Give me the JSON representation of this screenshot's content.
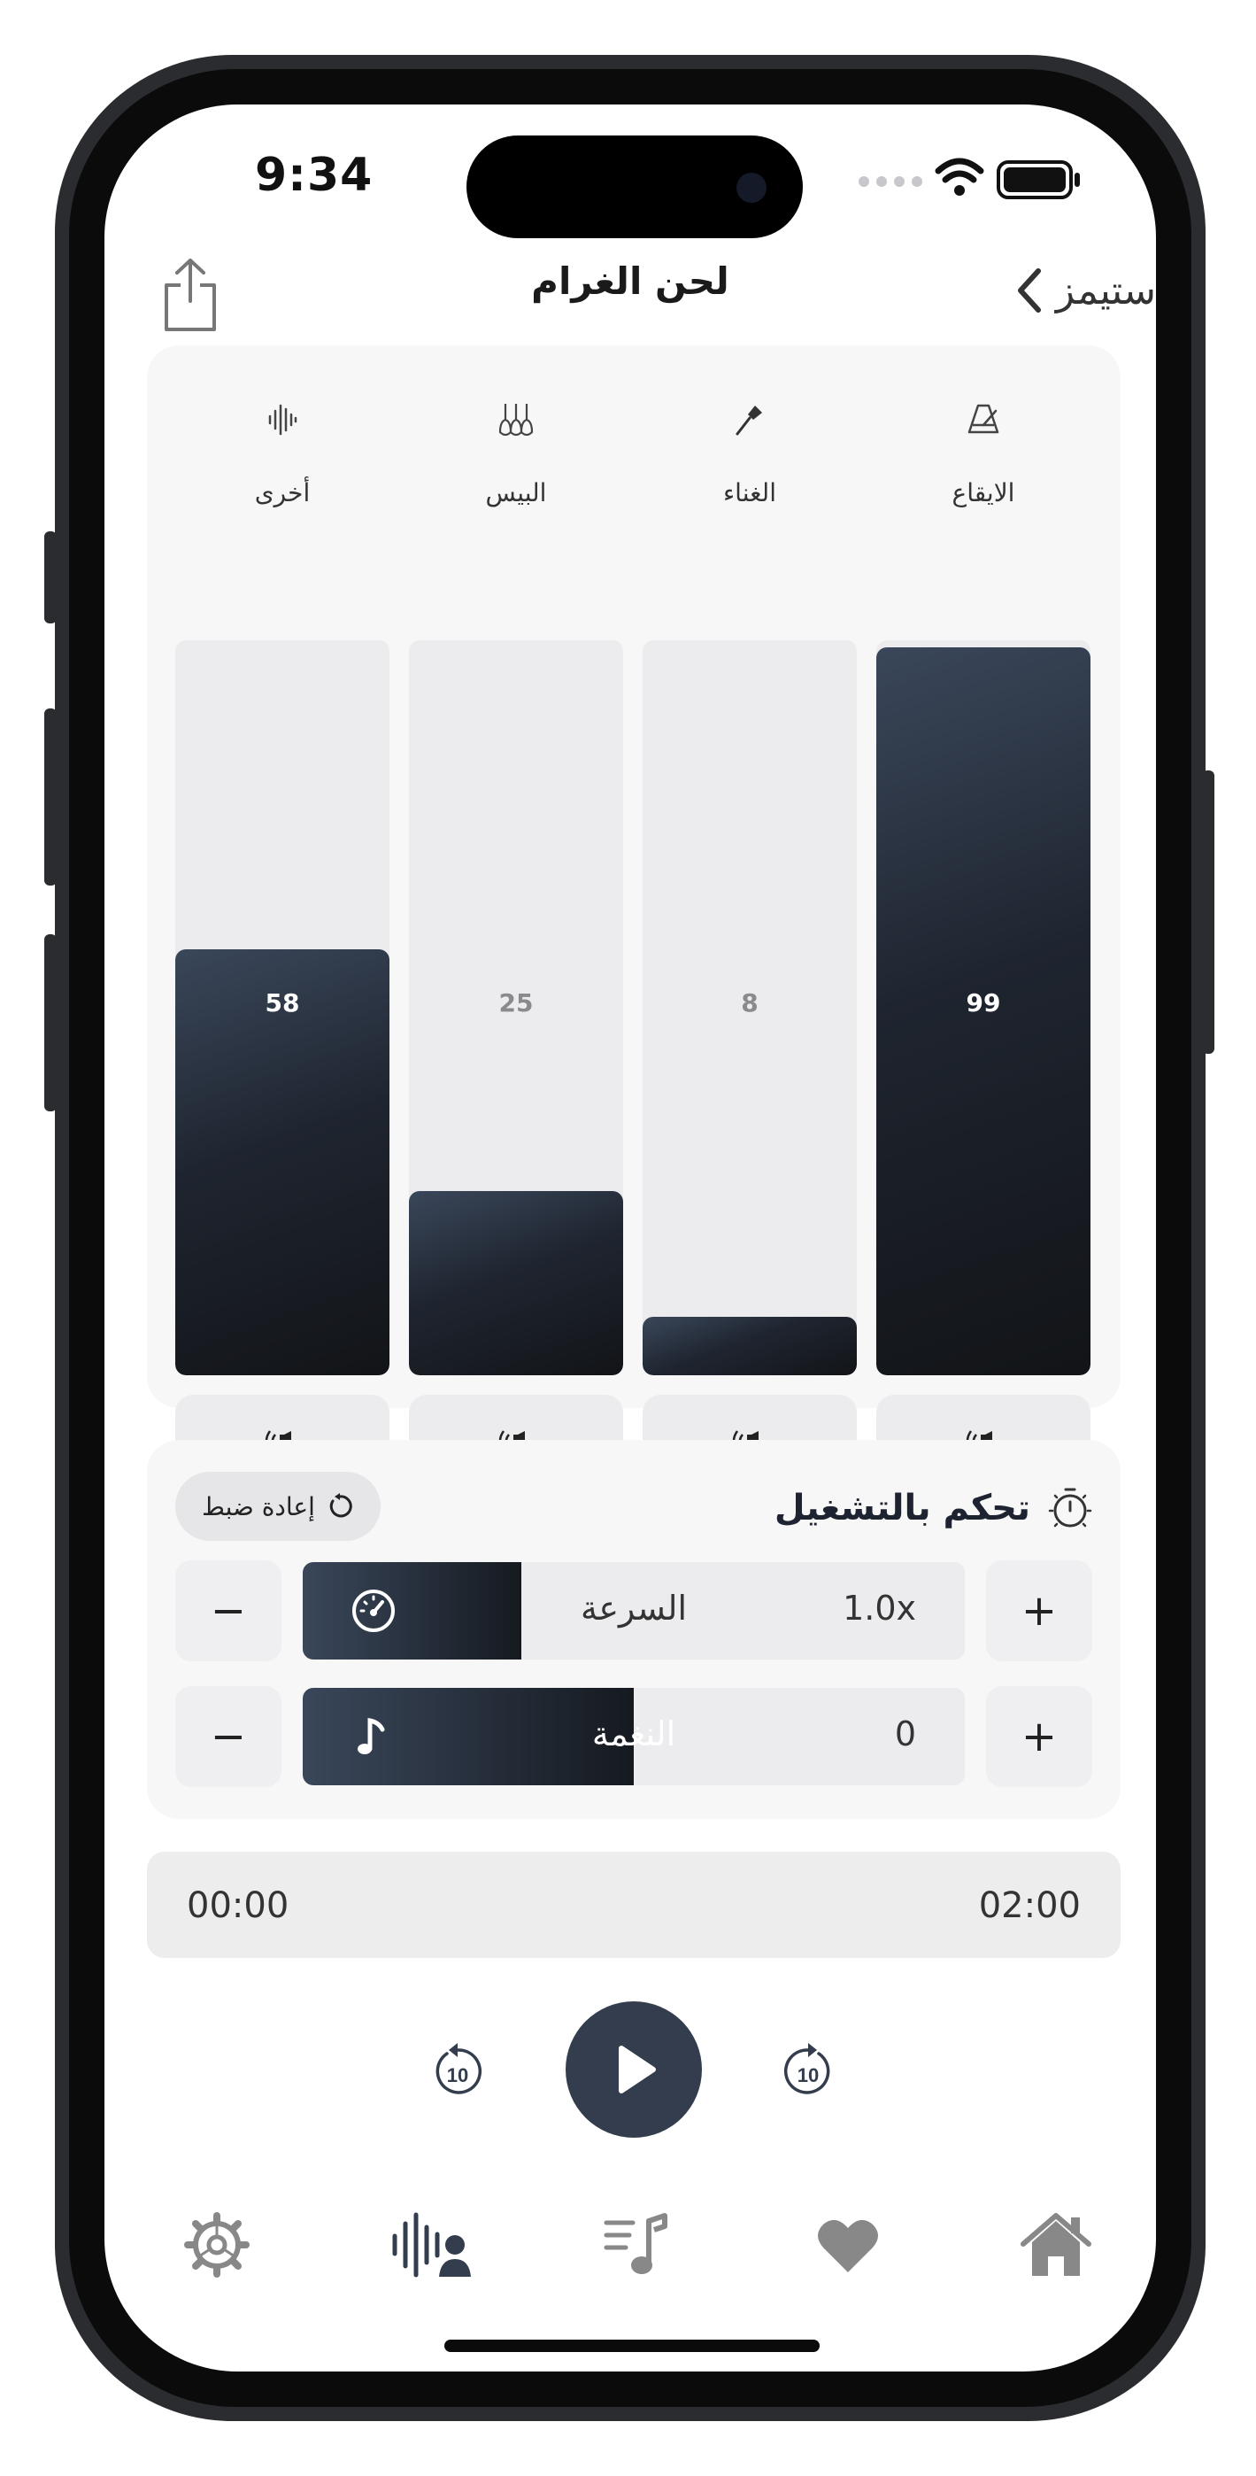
{
  "status_bar": {
    "time": "9:34"
  },
  "nav": {
    "title": "لحن الغرام",
    "back_label": "ستيمز"
  },
  "mixer": {
    "channels": [
      {
        "label": "الايقاع",
        "value": "99",
        "level": 0.99,
        "icon": "metronome-icon"
      },
      {
        "label": "الغناء",
        "value": "8",
        "level": 0.08,
        "icon": "microphone-icon"
      },
      {
        "label": "البيس",
        "value": "25",
        "level": 0.25,
        "icon": "guitars-icon"
      },
      {
        "label": "أخرى",
        "value": "58",
        "level": 0.58,
        "icon": "waveform-icon"
      }
    ]
  },
  "playback": {
    "title": "تحكم بالتشغيل",
    "reset_label": "إعادة ضبط",
    "speed": {
      "label": "السرعة",
      "value": "1.0x",
      "level": 0.33
    },
    "pitch": {
      "label": "النغمة",
      "value": "0",
      "level": 0.5
    },
    "minus": "−",
    "plus": "+"
  },
  "progress": {
    "elapsed": "00:00",
    "duration": "02:00"
  },
  "transport": {
    "skip_back": "10",
    "skip_forward": "10"
  },
  "tabs": [
    "settings-icon",
    "stems-icon",
    "playlist-icon",
    "favorites-icon",
    "home-icon"
  ],
  "colors": {
    "accent": "#333d4d",
    "card_bg": "#f7f7f8",
    "track_bg": "#ececee"
  }
}
